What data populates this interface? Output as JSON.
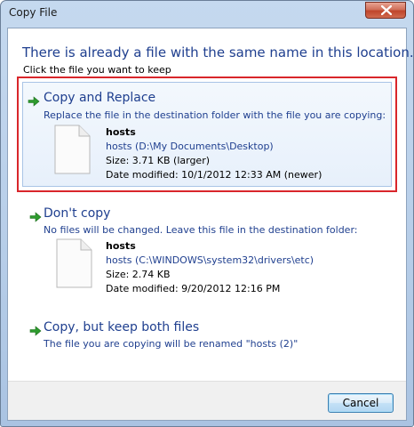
{
  "window": {
    "title": "Copy File",
    "close_icon": "close-icon"
  },
  "header": {
    "title": "There is already a file with the same name in this location.",
    "subtitle": "Click the file you want to keep"
  },
  "options": [
    {
      "title": "Copy and Replace",
      "description": "Replace the file in the destination folder with the file you are copying:",
      "selected": true,
      "file": {
        "name": "hosts",
        "path": "hosts (D:\\My Documents\\Desktop)",
        "size": "Size: 3.71 KB (larger)",
        "modified": "Date modified: 10/1/2012 12:33 AM (newer)"
      }
    },
    {
      "title": "Don't copy",
      "description": "No files will be changed. Leave this file in the destination folder:",
      "selected": false,
      "file": {
        "name": "hosts",
        "path": "hosts (C:\\WINDOWS\\system32\\drivers\\etc)",
        "size": "Size: 2.74 KB",
        "modified": "Date modified: 9/20/2012 12:16 PM"
      }
    },
    {
      "title": "Copy, but keep both files",
      "description": "The file you are copying will be renamed \"hosts (2)\"",
      "selected": false
    }
  ],
  "footer": {
    "cancel_label": "Cancel"
  },
  "colors": {
    "link_blue": "#1f3f8f",
    "highlight_red": "#d9262b",
    "arrow_green": "#2e9b2e"
  }
}
